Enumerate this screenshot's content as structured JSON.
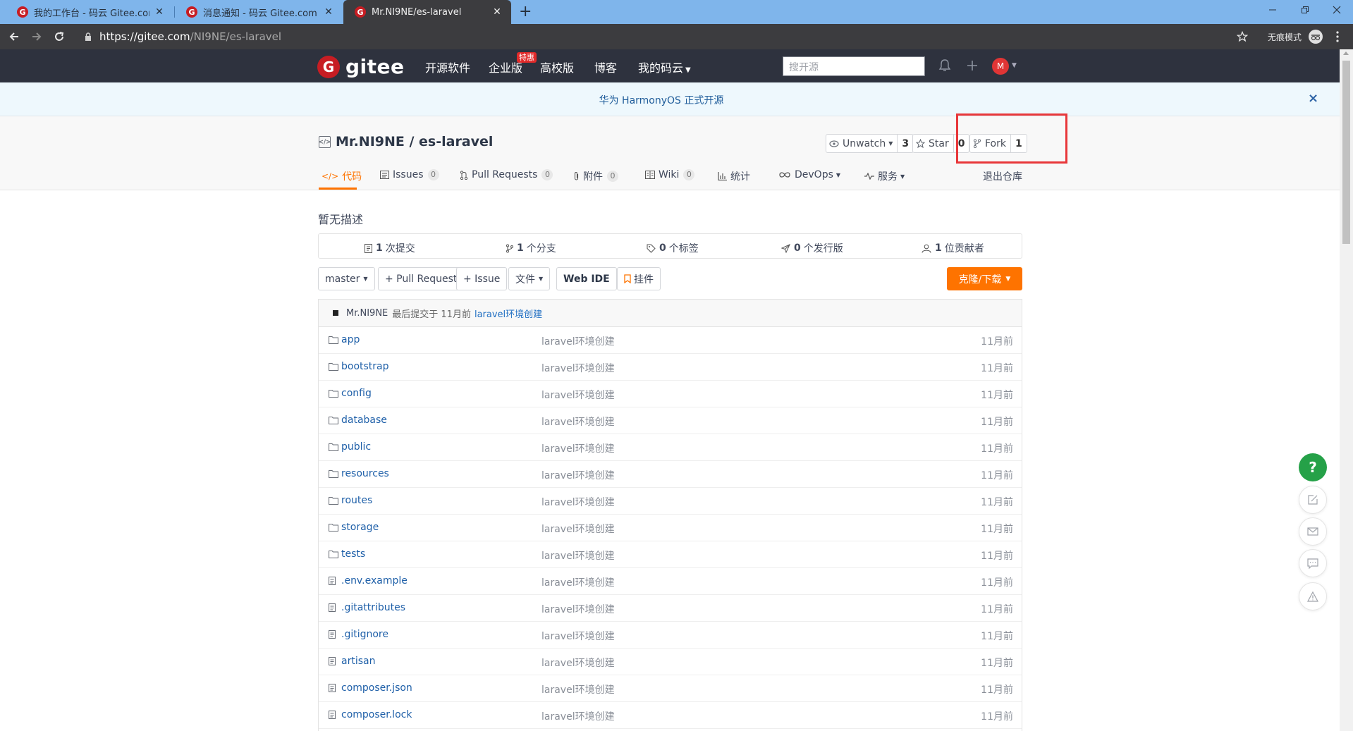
{
  "browser": {
    "tabs": [
      {
        "title": "我的工作台 - 码云 Gitee.com",
        "favicon": "gitee-favicon"
      },
      {
        "title": "消息通知 - 码云 Gitee.com",
        "favicon": "gitee-favicon"
      },
      {
        "title": "Mr.NI9NE/es-laravel",
        "favicon": "gitee-favicon",
        "active": true
      }
    ],
    "new_tab": "+",
    "url_host": "https://gitee.com",
    "url_path": "/NI9NE/es-laravel",
    "incognito_label": "无痕模式"
  },
  "header": {
    "logo_letter": "G",
    "logo_text": "gitee",
    "nav": [
      "开源软件",
      "企业版",
      "高校版",
      "博客",
      "我的码云"
    ],
    "hot_badge": "特惠",
    "search_placeholder": "搜开源",
    "avatar_letter": "M"
  },
  "notice": {
    "text": "华为 HarmonyOS 正式开源",
    "close": "×"
  },
  "repo": {
    "title": "Mr.NI9NE / es-laravel",
    "icon_text": "</>",
    "unwatch_label": "Unwatch",
    "unwatch_count": "3",
    "star_label": "Star",
    "star_count": "0",
    "fork_label": "Fork",
    "fork_count": "1",
    "tabs": [
      {
        "label": "代码",
        "icon": "code-icon",
        "active": true
      },
      {
        "label": "Issues",
        "icon": "issues-icon",
        "count": "0"
      },
      {
        "label": "Pull Requests",
        "icon": "pull-request-icon",
        "count": "0"
      },
      {
        "label": "附件",
        "icon": "attachment-icon",
        "count": "0"
      },
      {
        "label": "Wiki",
        "icon": "wiki-icon",
        "count": "0"
      },
      {
        "label": "统计",
        "icon": "stats-icon"
      },
      {
        "label": "DevOps",
        "icon": "devops-icon"
      },
      {
        "label": "服务",
        "icon": "service-icon"
      }
    ],
    "exit_label": "退出仓库"
  },
  "main": {
    "description": "暂无描述",
    "stats": [
      {
        "num": "1",
        "label": "次提交",
        "icon": "commit-icon"
      },
      {
        "num": "1",
        "label": "个分支",
        "icon": "branch-icon"
      },
      {
        "num": "0",
        "label": "个标签",
        "icon": "tag-icon"
      },
      {
        "num": "0",
        "label": "个发行版",
        "icon": "release-icon"
      },
      {
        "num": "1",
        "label": "位贡献者",
        "icon": "contributor-icon"
      }
    ],
    "branch": "master",
    "btn_pull_request": "+ Pull Request",
    "btn_issue": "+ Issue",
    "btn_file": "文件",
    "btn_webide": "Web IDE",
    "btn_plugin": "挂件",
    "btn_clone": "克隆/下载",
    "last_commit": {
      "author": "Mr.NI9NE",
      "meta": "最后提交于 11月前",
      "message": "laravel环境创建"
    },
    "files": [
      {
        "name": "app",
        "type": "folder",
        "commit": "laravel环境创建",
        "time": "11月前"
      },
      {
        "name": "bootstrap",
        "type": "folder",
        "commit": "laravel环境创建",
        "time": "11月前"
      },
      {
        "name": "config",
        "type": "folder",
        "commit": "laravel环境创建",
        "time": "11月前"
      },
      {
        "name": "database",
        "type": "folder",
        "commit": "laravel环境创建",
        "time": "11月前"
      },
      {
        "name": "public",
        "type": "folder",
        "commit": "laravel环境创建",
        "time": "11月前"
      },
      {
        "name": "resources",
        "type": "folder",
        "commit": "laravel环境创建",
        "time": "11月前"
      },
      {
        "name": "routes",
        "type": "folder",
        "commit": "laravel环境创建",
        "time": "11月前"
      },
      {
        "name": "storage",
        "type": "folder",
        "commit": "laravel环境创建",
        "time": "11月前"
      },
      {
        "name": "tests",
        "type": "folder",
        "commit": "laravel环境创建",
        "time": "11月前"
      },
      {
        "name": ".env.example",
        "type": "file",
        "commit": "laravel环境创建",
        "time": "11月前"
      },
      {
        "name": ".gitattributes",
        "type": "file",
        "commit": "laravel环境创建",
        "time": "11月前"
      },
      {
        "name": ".gitignore",
        "type": "file",
        "commit": "laravel环境创建",
        "time": "11月前"
      },
      {
        "name": "artisan",
        "type": "file",
        "commit": "laravel环境创建",
        "time": "11月前"
      },
      {
        "name": "composer.json",
        "type": "file",
        "commit": "laravel环境创建",
        "time": "11月前"
      },
      {
        "name": "composer.lock",
        "type": "file",
        "commit": "laravel环境创建",
        "time": "11月前"
      }
    ]
  },
  "floating": {
    "help": "?"
  },
  "colors": {
    "accent": "#fe7300",
    "header_bg": "#2e323e",
    "brand_red": "#c71d23",
    "highlight_box": "#e8373a",
    "help_green": "#25a148",
    "link_blue": "#1e5fa8"
  }
}
